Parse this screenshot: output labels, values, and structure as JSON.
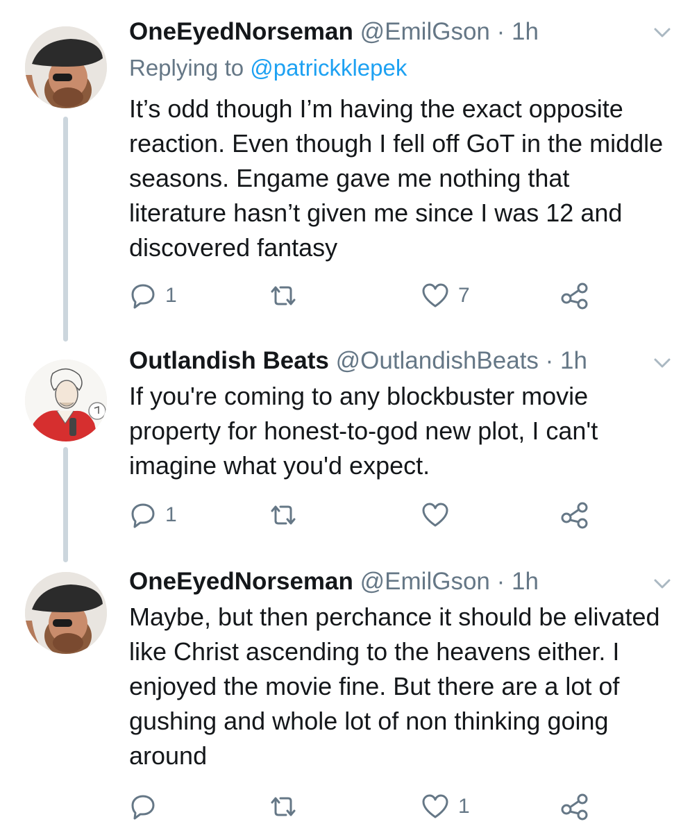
{
  "tweets": [
    {
      "author_name": "OneEyedNorseman",
      "handle": "@EmilGson",
      "separator": "·",
      "time": "1h",
      "reply_label": "Replying to ",
      "reply_to": "@patrickklepek",
      "text": "It’s odd though I’m having the exact opposite reaction. Even though I fell off GoT in the middle seasons. Engame gave me nothing that literature hasn’t given me since I was 12 and discovered fantasy",
      "reply_count": "1",
      "retweet_count": "",
      "like_count": "7",
      "avatar": "man-with-cap-eyepatch"
    },
    {
      "author_name": "Outlandish Beats",
      "handle": "@OutlandishBeats",
      "separator": "·",
      "time": "1h",
      "text": "If you're coming to any blockbuster movie property for honest-to-god new plot, I can't imagine what you'd expect.",
      "reply_count": "1",
      "retweet_count": "",
      "like_count": "",
      "avatar": "drawn-singer-red-shirt"
    },
    {
      "author_name": "OneEyedNorseman",
      "handle": "@EmilGson",
      "separator": "·",
      "time": "1h",
      "text": "Maybe, but then perchance it should be elivated like Christ ascending to the heavens either. I enjoyed the movie fine. But there are a lot of gushing and whole lot of non thinking going around",
      "reply_count": "",
      "retweet_count": "",
      "like_count": "1",
      "avatar": "man-with-cap-eyepatch"
    }
  ],
  "colors": {
    "text": "#14171a",
    "muted": "#657786",
    "link": "#1da1f2",
    "thread_line": "#ccd6dd"
  },
  "icons": [
    "reply-icon",
    "retweet-icon",
    "like-icon",
    "share-icon",
    "chevron-down-icon"
  ]
}
